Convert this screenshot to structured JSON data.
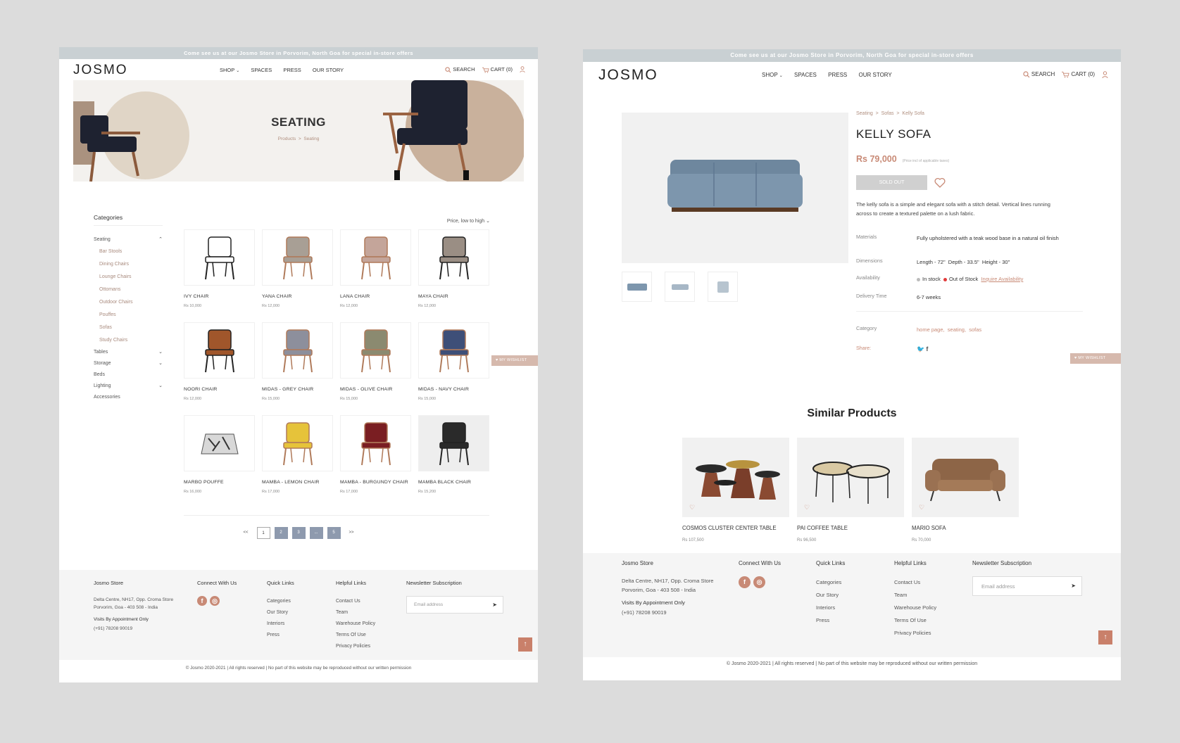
{
  "listing": {
    "announcement": "Come see us at our Josmo Store in Porvorim, North Goa for special in-store offers",
    "logo": "JOSMO",
    "nav": [
      "SHOP",
      "SPACES",
      "PRESS",
      "OUR STORY"
    ],
    "search_label": "SEARCH",
    "cart_label": "CART (0)",
    "hero_title": "SEATING",
    "hero_breadcrumb": [
      "Products",
      ">",
      "Seating"
    ],
    "categories_heading": "Categories",
    "categories": [
      {
        "label": "Seating",
        "chevron": "chevron-up-icon"
      },
      {
        "label": "Tables",
        "chevron": "chevron-down-icon"
      },
      {
        "label": "Storage",
        "chevron": "chevron-down-icon"
      },
      {
        "label": "Beds",
        "chevron": ""
      },
      {
        "label": "Lighting",
        "chevron": "chevron-down-icon"
      },
      {
        "label": "Accessories",
        "chevron": ""
      }
    ],
    "subcategories": [
      "Bar Stools",
      "Dining Chairs",
      "Lounge Chairs",
      "Ottomans",
      "Outdoor Chairs",
      "Pouffes",
      "Sofas",
      "Study Chairs"
    ],
    "sort_label": "Price, low to high",
    "products": [
      {
        "name": "IVY CHAIR",
        "price": "Rs 10,000",
        "color": "#ffffff"
      },
      {
        "name": "YANA CHAIR",
        "price": "Rs 12,000",
        "color": "#a89f95"
      },
      {
        "name": "LANA CHAIR",
        "price": "Rs 12,000",
        "color": "#c4a59a"
      },
      {
        "name": "MAYA CHAIR",
        "price": "Rs 12,000",
        "color": "#9a8e84"
      },
      {
        "name": "NOORI CHAIR",
        "price": "Rs 12,000",
        "color": "#a0562b"
      },
      {
        "name": "MIDAS - GREY CHAIR",
        "price": "Rs 15,000",
        "color": "#8d8f9c"
      },
      {
        "name": "MIDAS - OLIVE CHAIR",
        "price": "Rs 15,000",
        "color": "#8b8a70"
      },
      {
        "name": "MIDAS - NAVY CHAIR",
        "price": "Rs 15,000",
        "color": "#3e4f78"
      },
      {
        "name": "MARBO POUFFE",
        "price": "Rs 16,000",
        "color": "#d8d8d8"
      },
      {
        "name": "MAMBA - LEMON CHAIR",
        "price": "Rs 17,000",
        "color": "#e6c33a"
      },
      {
        "name": "MAMBA - BURGUNDY CHAIR",
        "price": "Rs 17,000",
        "color": "#7a1e22"
      },
      {
        "name": "MAMBA BLACK CHAIR",
        "price": "Rs 15,200",
        "color": "#2a2a2a"
      }
    ],
    "pagination": [
      "<<",
      "1",
      "2",
      "3",
      "...",
      "5",
      ">>"
    ],
    "wishlist_tab": "MY WISHLIST",
    "footer": {
      "store_heading": "Josmo Store",
      "address": "Delta Centre, NH17, Opp. Croma Store Porvorim, Goa - 403 508 - India",
      "appointment": "Visits By Appointment Only",
      "phone": "(+91) 78208 90019",
      "connect_heading": "Connect With Us",
      "quick_heading": "Quick Links",
      "quick_links": [
        "Categories",
        "Our Story",
        "Interiors",
        "Press"
      ],
      "helpful_heading": "Helpful Links",
      "helpful_links": [
        "Contact Us",
        "Team",
        "Warehouse Policy",
        "Terms Of Use",
        "Privacy Policies"
      ],
      "newsletter_heading": "Newsletter Subscription",
      "email_placeholder": "Email address",
      "copyright": "© Josmo 2020-2021 | All rights reserved | No part of this website may be reproduced without our written permission"
    }
  },
  "product": {
    "breadcrumb": [
      "Seating",
      ">",
      "Sofas",
      ">",
      "Kelly Sofa"
    ],
    "title": "KELLY SOFA",
    "price": "Rs 79,000",
    "price_note": "(Price incl of applicable taxes)",
    "sold_out_label": "SOLD OUT",
    "description": "The kelly sofa is a simple and elegant sofa with a stitch detail. Vertical lines running across to create a textured palette on a lush fabric.",
    "materials_label": "Materials",
    "materials": "Fully upholstered with a teak wood base in a natural oil finish",
    "dimensions_label": "Dimensions",
    "dimensions": [
      "Length - 72\"",
      "Depth - 33.5\"",
      "Height - 30\""
    ],
    "availability_label": "Availability",
    "in_stock": "In stock",
    "out_of_stock": "Out of Stock",
    "inquire": "Inquire Availability",
    "delivery_label": "Delivery Time",
    "delivery": "6-7 weeks",
    "category_label": "Category",
    "categories": [
      "home page,",
      "seating,",
      "sofas"
    ],
    "share_label": "Share:",
    "similar_heading": "Similar Products",
    "similar": [
      {
        "name": "COSMOS CLUSTER CENTER TABLE",
        "price": "Rs 107,500"
      },
      {
        "name": "PAI COFFEE TABLE",
        "price": "Rs 96,500"
      },
      {
        "name": "MARIO SOFA",
        "price": "Rs 70,000"
      }
    ],
    "colors": {
      "accent": "#c88a76",
      "sofa": "#7d96ad"
    }
  }
}
